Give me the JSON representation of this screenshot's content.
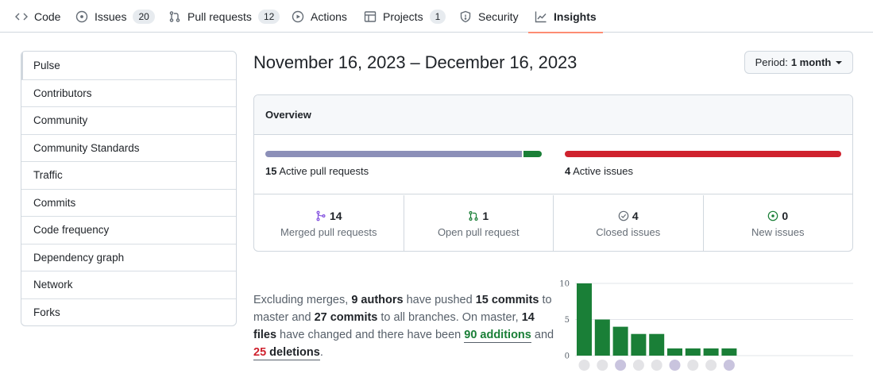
{
  "nav": {
    "tabs": [
      {
        "label": "Code",
        "icon": "code-icon"
      },
      {
        "label": "Issues",
        "icon": "issue-opened-icon",
        "count": "20"
      },
      {
        "label": "Pull requests",
        "icon": "git-pull-request-icon",
        "count": "12"
      },
      {
        "label": "Actions",
        "icon": "play-icon"
      },
      {
        "label": "Projects",
        "icon": "table-icon",
        "count": "1"
      },
      {
        "label": "Security",
        "icon": "shield-icon"
      },
      {
        "label": "Insights",
        "icon": "graph-icon",
        "active": true
      }
    ]
  },
  "sidebar": {
    "items": [
      {
        "label": "Pulse",
        "selected": true
      },
      {
        "label": "Contributors"
      },
      {
        "label": "Community"
      },
      {
        "label": "Community Standards"
      },
      {
        "label": "Traffic"
      },
      {
        "label": "Commits"
      },
      {
        "label": "Code frequency"
      },
      {
        "label": "Dependency graph"
      },
      {
        "label": "Network"
      },
      {
        "label": "Forks"
      }
    ]
  },
  "header": {
    "date_range": "November 16, 2023 – December 16, 2023",
    "period_label": "Period:",
    "period_value": "1 month"
  },
  "overview": {
    "title": "Overview",
    "pull_requests": {
      "count": "15",
      "label": "Active pull requests",
      "merged_fraction": 0.933,
      "open_fraction": 0.067
    },
    "issues": {
      "count": "4",
      "label": "Active issues",
      "closed_fraction": 1.0
    },
    "stats": [
      {
        "value": "14",
        "label": "Merged pull requests",
        "icon": "git-merge-icon",
        "color": "#8250df"
      },
      {
        "value": "1",
        "label": "Open pull request",
        "icon": "git-pull-request-icon",
        "color": "#1a7f37"
      },
      {
        "value": "4",
        "label": "Closed issues",
        "icon": "issue-closed-icon",
        "color": "#656d76"
      },
      {
        "value": "0",
        "label": "New issues",
        "icon": "issue-opened-icon",
        "color": "#1a7f37"
      }
    ]
  },
  "summary": {
    "t1": "Excluding merges, ",
    "authors": "9 authors",
    "t2": " have pushed ",
    "commits": "15 commits",
    "t3": " to master and ",
    "all_commits": "27 commits",
    "t4": " to all branches. On master, ",
    "files": "14 files",
    "t5": " have changed and there have been ",
    "additions": "90 additions",
    "t6": " and ",
    "deletions_num": "25",
    "deletions_word": " deletions",
    "t7": "."
  },
  "chart_data": {
    "type": "bar",
    "values": [
      10,
      5,
      4,
      3,
      3,
      1,
      1,
      1,
      1
    ],
    "ylim": [
      0,
      10
    ],
    "yticks": [
      "10",
      "5",
      "0"
    ],
    "bar_color": "#1a7f37"
  },
  "colors": {
    "merged_bar": "#8c8fb8",
    "open_bar": "#1a7f37",
    "issues_bar": "#cf222e",
    "tab_underline": "#fd8c73"
  }
}
